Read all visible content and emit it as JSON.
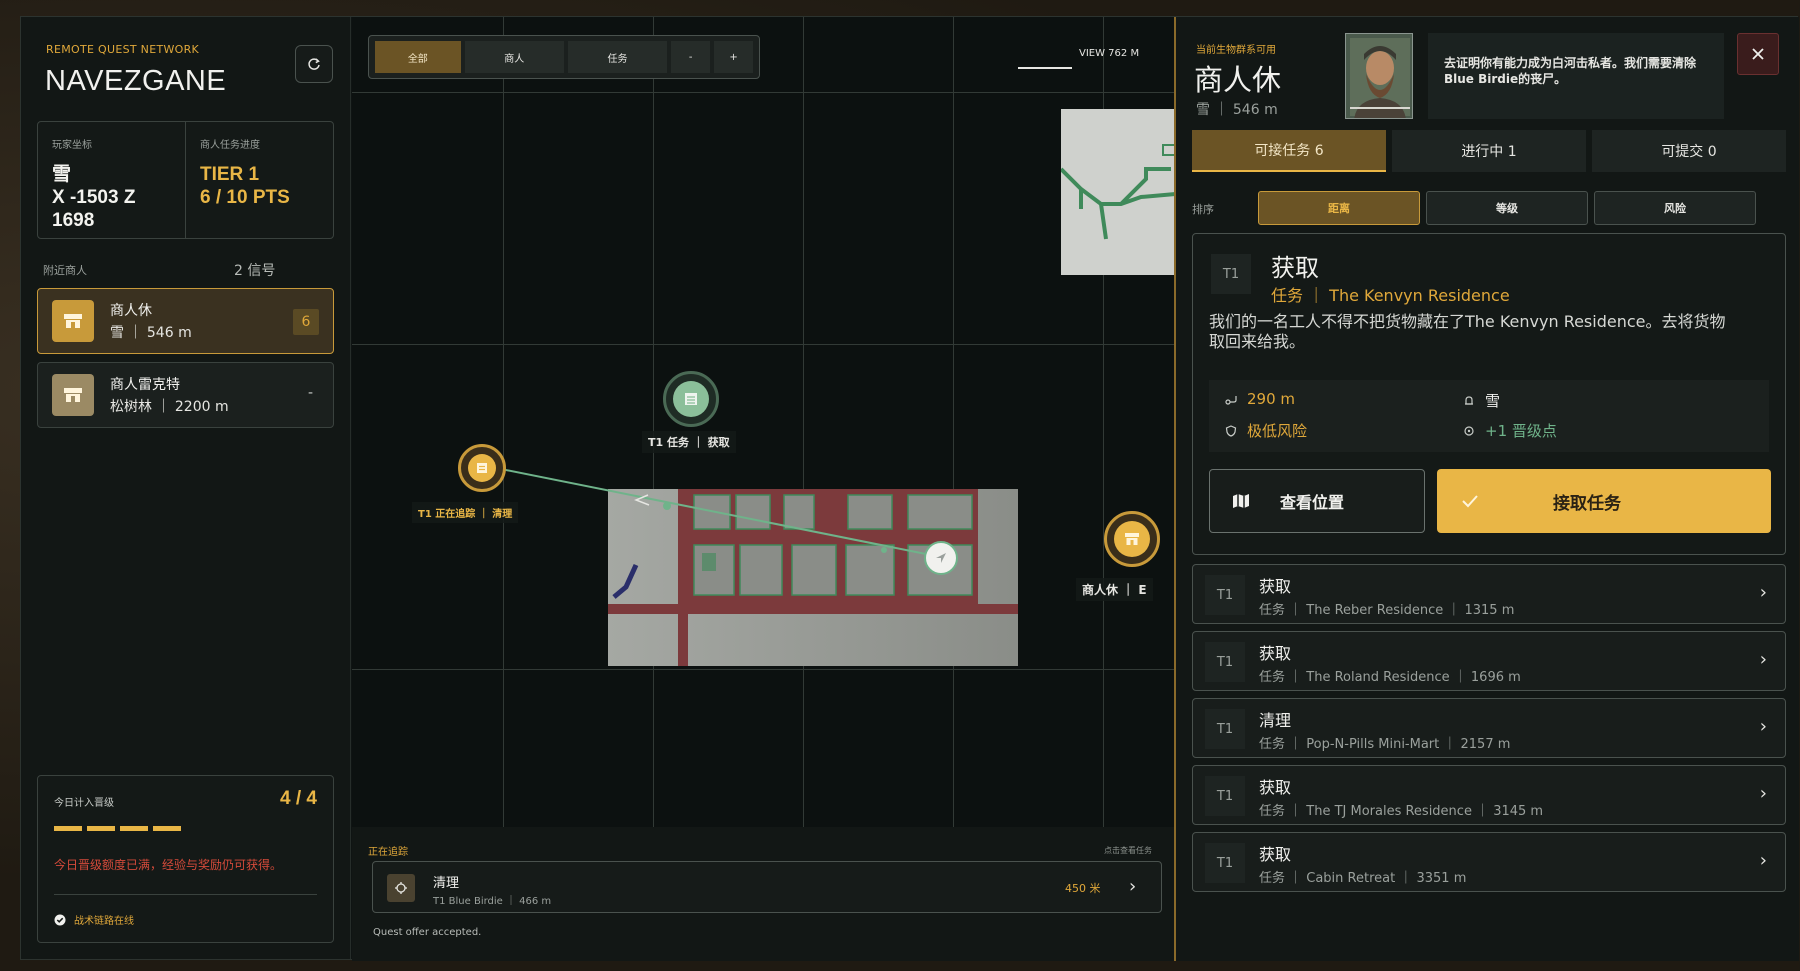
{
  "left": {
    "network_label": "REMOTE QUEST NETWORK",
    "title": "NAVEZGANE",
    "coords_label": "玩家坐标",
    "coords_value": "雪\nX -1503 Z\n1698",
    "progress_label": "商人任务进度",
    "progress_tier": "TIER 1",
    "progress_pts": "6 / 10 PTS",
    "nearby_label": "附近商人",
    "nearby_count": "2 信号",
    "traders": [
      {
        "name": "商人休",
        "sub": "雪 ｜ 546 m",
        "badge": "6"
      },
      {
        "name": "商人雷克特",
        "sub": "松树林 ｜ 2200 m",
        "badge": "-"
      }
    ],
    "daily_label": "今日计入晋级",
    "daily_count": "4 / 4",
    "daily_progress": 1.0,
    "daily_msg": "今日晋级额度已满，经验与奖励仍可获得。",
    "daily_link": "战术链路在线"
  },
  "map": {
    "filters": [
      "全部",
      "商人",
      "任务",
      "-",
      "+"
    ],
    "view_label": "VIEW 762 M",
    "poi_task": "T1 任务 ｜ 获取",
    "poi_tracking": "T1 正在追踪 ｜ 清理",
    "poi_trader": "商人休 ｜ E",
    "tracking_label": "正在追踪",
    "tracking_hint": "点击查看任务",
    "tracking_title": "清理",
    "tracking_sub": "T1  Blue Birdie ｜ 466 m",
    "tracking_dist": "450 米",
    "status": "Quest offer accepted."
  },
  "right": {
    "avail_label": "当前生物群系可用",
    "npc_name": "商人休",
    "npc_loc": "雪 ｜ 546 m",
    "quote": "去证明你有能力成为白河击私者。我们需要清除Blue Birdie的丧尸。",
    "tabs": [
      "可接任务  6",
      "进行中  1",
      "可提交  0"
    ],
    "sort_label": "排序",
    "sorts": [
      "距离",
      "等级",
      "风险"
    ],
    "detail": {
      "tier": "T1",
      "title": "获取",
      "sub": "任务 ｜ The Kenvyn Residence",
      "desc": "我们的一名工人不得不把货物藏在了The Kenvyn Residence。去将货物取回来给我。",
      "distance": "290 m",
      "biome": "雪",
      "risk": "极低风险",
      "reward": "+1 晋级点",
      "view_btn": "查看位置",
      "accept_btn": "接取任务"
    },
    "quests": [
      {
        "tier": "T1",
        "title": "获取",
        "sub": "任务 ｜ The Reber Residence ｜ 1315 m"
      },
      {
        "tier": "T1",
        "title": "获取",
        "sub": "任务 ｜ The Roland Residence ｜ 1696 m"
      },
      {
        "tier": "T1",
        "title": "清理",
        "sub": "任务 ｜ Pop-N-Pills Mini-Mart ｜ 2157 m"
      },
      {
        "tier": "T1",
        "title": "获取",
        "sub": "任务 ｜ The TJ Morales Residence ｜ 3145 m"
      },
      {
        "tier": "T1",
        "title": "获取",
        "sub": "任务 ｜ Cabin Retreat ｜ 3351 m"
      }
    ]
  }
}
